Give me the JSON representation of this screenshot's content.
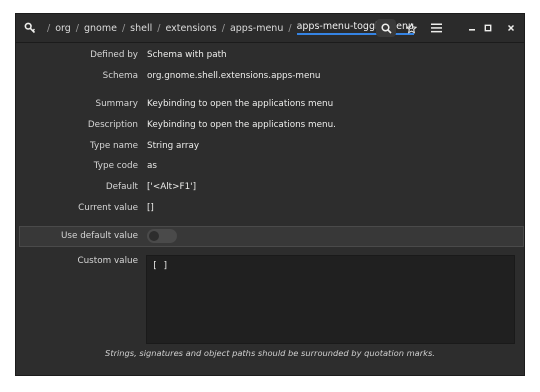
{
  "breadcrumbs": [
    "org",
    "gnome",
    "shell",
    "extensions",
    "apps-menu",
    "apps-menu-toggle-menu"
  ],
  "breadcrumb_separator": "/",
  "fields": {
    "defined_by": {
      "label": "Defined by",
      "value": "Schema with path"
    },
    "schema": {
      "label": "Schema",
      "value": "org.gnome.shell.extensions.apps-menu"
    },
    "summary": {
      "label": "Summary",
      "value": "Keybinding to open the applications menu"
    },
    "description": {
      "label": "Description",
      "value": "Keybinding to open the applications menu."
    },
    "type_name": {
      "label": "Type name",
      "value": "String array"
    },
    "type_code": {
      "label": "Type code",
      "value": "as"
    },
    "default": {
      "label": "Default",
      "value": "['<Alt>F1']"
    },
    "current_value": {
      "label": "Current value",
      "value": "[]"
    }
  },
  "use_default": {
    "label": "Use default value",
    "checked": false
  },
  "custom_value": {
    "label": "Custom value",
    "value": "[ ]"
  },
  "footer_note": "Strings, signatures and object paths should be surrounded by quotation marks.",
  "colors": {
    "window_bg": "#2d2d2d",
    "accent": "#3584e4",
    "text": "#eeeeec"
  }
}
